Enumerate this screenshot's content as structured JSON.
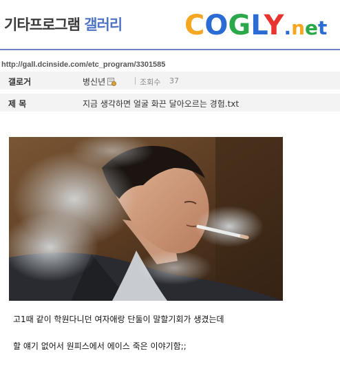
{
  "header": {
    "gallery_name": "기타프로그램",
    "gallery_suffix": "갤러리",
    "logo": {
      "letters": [
        "C",
        "O",
        "G",
        "L",
        "Y",
        ".",
        "n",
        "e",
        "t"
      ],
      "colors": [
        "#f5a623",
        "#2b6cd4",
        "#2aa84a",
        "#2b6cd4",
        "#e8332f",
        "#2b6cd4",
        "#f5a623",
        "#2aa84a",
        "#2b6cd4"
      ]
    }
  },
  "url": "http://gall.dcinside.com/etc_program/3301585",
  "post": {
    "writer_label": "갤로거",
    "writer_name": "병신년",
    "view_label": "조회수",
    "view_count": "37",
    "title_label": "제 목",
    "title": "지금 생각하면 얼굴 화끈 달아오르는 경험.txt"
  },
  "content": {
    "image_icon": "man-smoking-photo",
    "line1": "고1때 같이 학원다니던 여자애랑 단둘이 말할기회가 생겼는데",
    "line2": "할 얘기 없어서 원피스에서 에이스 죽은  이야기함;;"
  }
}
